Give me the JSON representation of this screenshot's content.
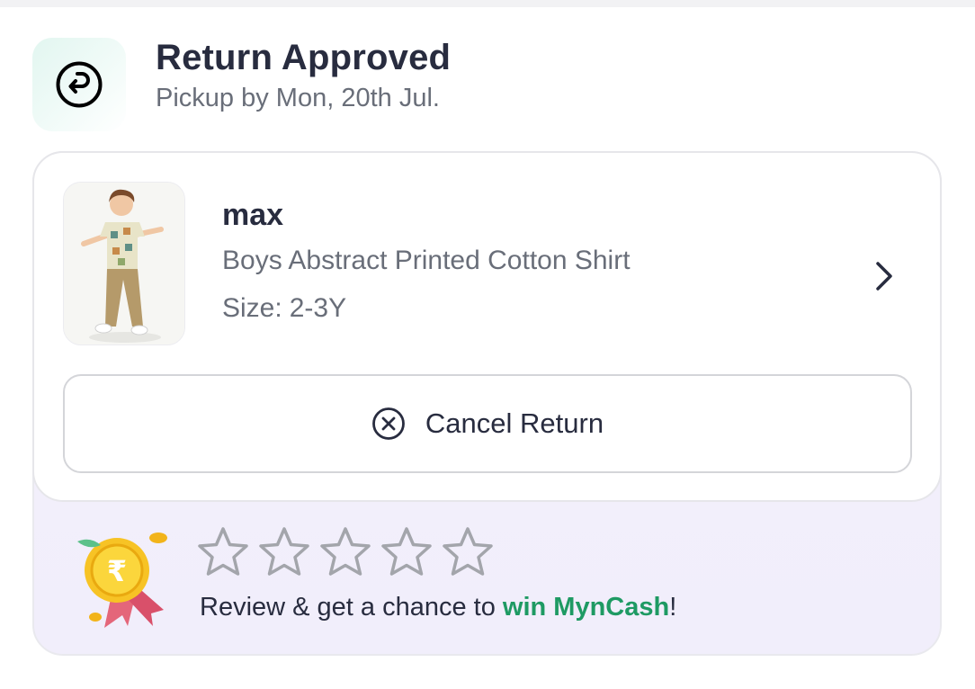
{
  "status": {
    "title": "Return Approved",
    "subtitle": "Pickup by Mon, 20th Jul.",
    "icon": "return-arrow-icon"
  },
  "product": {
    "brand": "max",
    "name": "Boys Abstract Printed Cotton Shirt",
    "size_label": "Size:",
    "size_value": "2-3Y"
  },
  "actions": {
    "cancel_label": "Cancel Return",
    "cancel_icon": "close-circle-icon"
  },
  "review": {
    "rating": 0,
    "max_rating": 5,
    "text_before": "Review & get a chance to ",
    "highlight": "win MynCash",
    "text_after": "!",
    "highlight_color": "#1e9a63",
    "icon": "myncash-medal-icon"
  }
}
